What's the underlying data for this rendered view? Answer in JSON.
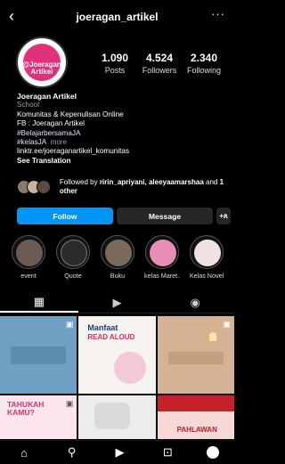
{
  "header": {
    "back_icon": "‹",
    "username": "joeragan_artikel",
    "more_icon": "···"
  },
  "avatar": {
    "logo_line1": "@Joeragan",
    "logo_line2": "Artikel"
  },
  "stats": [
    {
      "value": "1.090",
      "label": "Posts"
    },
    {
      "value": "4.524",
      "label": "Followers"
    },
    {
      "value": "2.340",
      "label": "Following"
    }
  ],
  "bio": {
    "name": "Joeragan Artikel",
    "category": "School",
    "lines": [
      "Komunitas & Kepenulisan Online",
      "FB : Joeragan Artikel",
      "#BelajarbersamaJA"
    ],
    "tag_line": "#kelasJA",
    "more": "more",
    "link": "linktr.ee/joeraganartikel_komunitas",
    "translate": "See Translation"
  },
  "followed": {
    "prefix": "Followed by ",
    "names": "ririn_apriyani, aleeyaamarshaa",
    "suffix_and": " and ",
    "others": "1 other"
  },
  "buttons": {
    "follow": "Follow",
    "message": "Message",
    "add_user": "+ጸ"
  },
  "highlights": [
    {
      "label": "event"
    },
    {
      "label": "Quote"
    },
    {
      "label": "Buku"
    },
    {
      "label": "kelas Maret..."
    },
    {
      "label": "Kelas Novel"
    }
  ],
  "tabs": {
    "grid": "▦",
    "reels": "▶",
    "tagged": "◉"
  },
  "posts": {
    "p2_title": "Manfaat",
    "p2_subtitle": "READ ALOUD",
    "p4_title": "TAHUKAH KAMU?",
    "p6_title": "PAHLAWAN"
  },
  "bottom_nav": {
    "home": "⌂",
    "search": "⚲",
    "reels": "▶",
    "shop": "⊡"
  }
}
